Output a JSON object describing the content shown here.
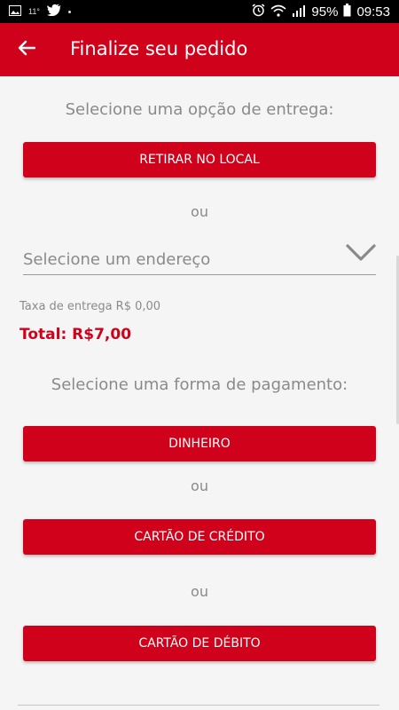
{
  "status_bar": {
    "left_small_text": "11°",
    "battery": "95%",
    "time": "09:53",
    "icons": [
      "image-icon",
      "twitter-icon",
      "alarm-icon",
      "wifi-icon",
      "signal-icon",
      "battery-icon"
    ]
  },
  "app_bar": {
    "title": "Finalize seu pedido",
    "back_icon": "arrow-left-icon",
    "color": "#d0021b"
  },
  "delivery": {
    "title": "Selecione uma opção de entrega:",
    "pickup_label": "RETIRAR NO LOCAL",
    "or_label": "ou",
    "address_placeholder": "Selecione um endereço",
    "address_icon": "chevron-down-icon"
  },
  "summary": {
    "fee": "Taxa de entrega R$ 0,00",
    "total": "Total: R$7,00"
  },
  "payment": {
    "title": "Selecione uma forma de pagamento:",
    "options": [
      "DINHEIRO",
      "CARTÃO DE CRÉDITO",
      "CARTÃO DE DÉBITO"
    ],
    "or_label": "ou"
  },
  "colors": {
    "accent": "#d0021b",
    "muted_text": "#8a8a8a",
    "background": "#f5f5f5"
  }
}
